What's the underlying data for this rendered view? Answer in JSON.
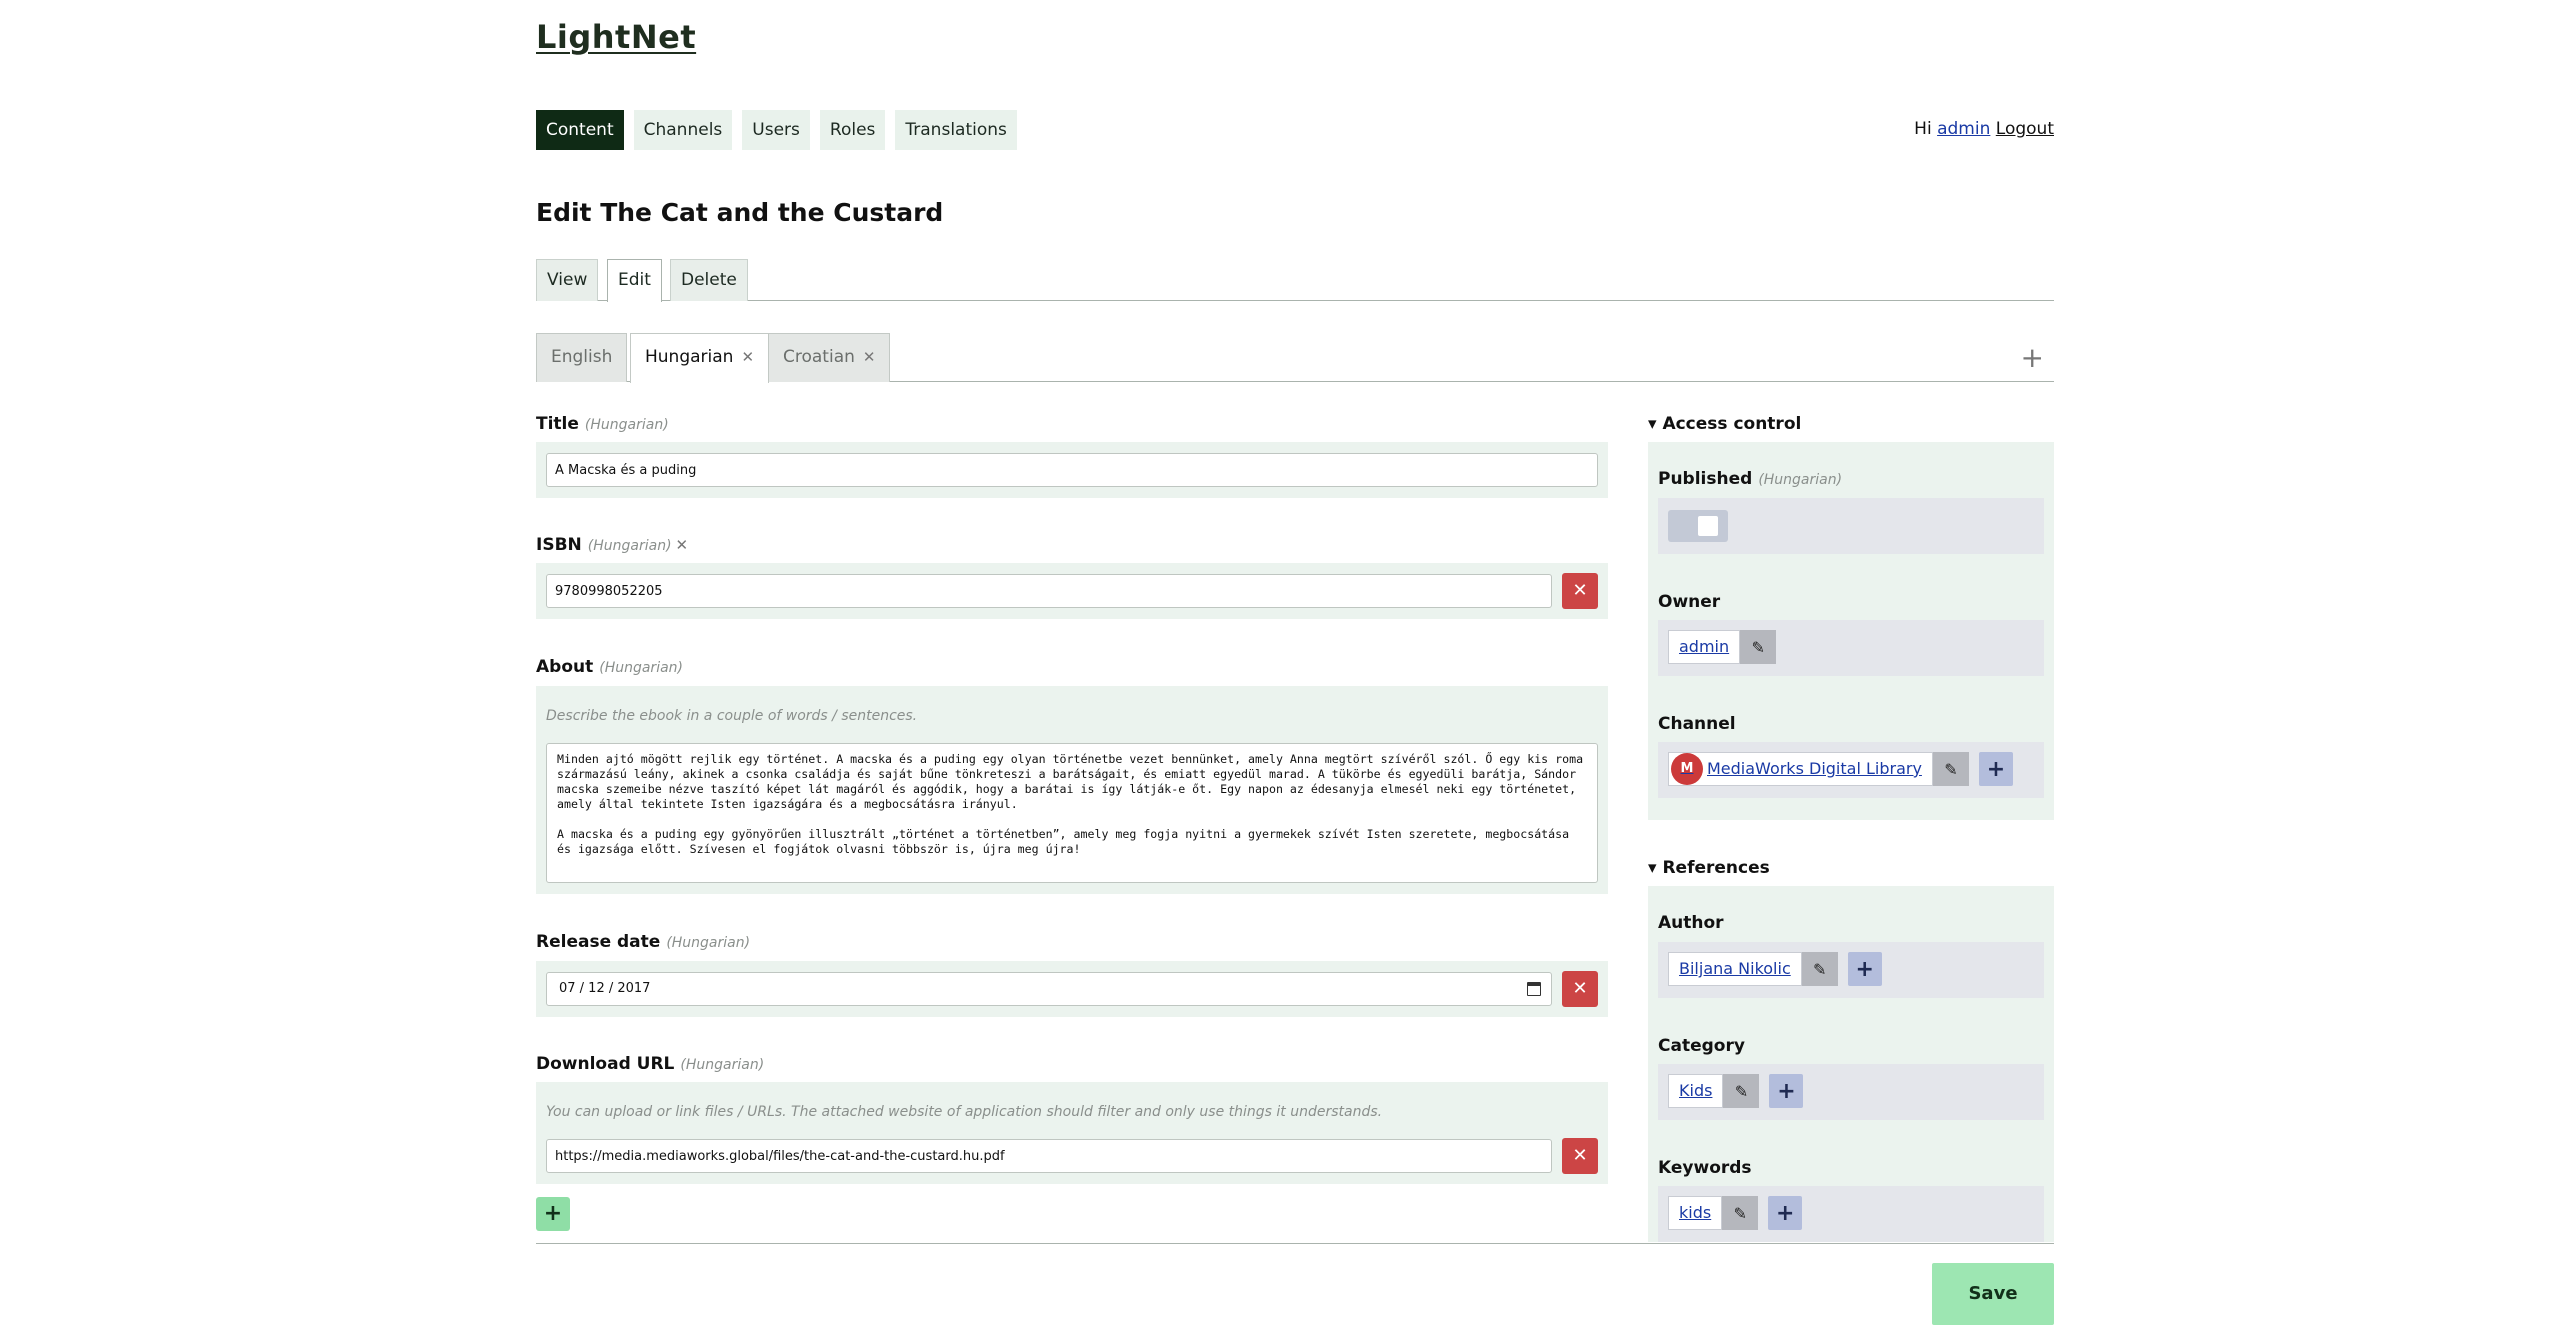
{
  "site": {
    "title": "LightNet"
  },
  "nav": {
    "items": [
      {
        "label": "Content",
        "active": true
      },
      {
        "label": "Channels",
        "active": false
      },
      {
        "label": "Users",
        "active": false
      },
      {
        "label": "Roles",
        "active": false
      },
      {
        "label": "Translations",
        "active": false
      }
    ]
  },
  "user": {
    "greeting": "Hi",
    "name": "admin",
    "logout": "Logout"
  },
  "page": {
    "title": "Edit The Cat and the Custard"
  },
  "ops_tabs": {
    "view": "View",
    "edit": "Edit",
    "delete": "Delete",
    "active": "Edit"
  },
  "lang_tabs": {
    "items": [
      {
        "label": "English",
        "active": false
      },
      {
        "label": "Hungarian",
        "active": true
      },
      {
        "label": "Croatian",
        "active": false
      }
    ],
    "close_glyph": "✕",
    "add_glyph": "+"
  },
  "lang_tag": "(Hungarian)",
  "fields": {
    "title": {
      "label": "Title",
      "value": "A Macska és a puding"
    },
    "isbn": {
      "label": "ISBN",
      "value": "9780998052205"
    },
    "about": {
      "label": "About",
      "hint": "Describe the ebook in a couple of words / sentences.",
      "value": "Minden ajtó mögött rejlik egy történet. A macska és a puding egy olyan történetbe vezet bennünket, amely Anna megtört szívéről szól. Ő egy kis roma származású leány, akinek a csonka családja és saját bűne tönkreteszi a barátságait, és emiatt egyedül marad. A tükörbe és egyedüli barátja, Sándor macska szemeibe nézve taszító képet lát magáról és aggódik, hogy a barátai is így látják-e őt. Egy napon az édesanyja elmesél neki egy történetet, amely által tekintete Isten igazságára és a megbocsátásra irányul.\n\nA macska és a puding egy gyönyörűen illusztrált „történet a történetben”, amely meg fogja nyitni a gyermekek szívét Isten szeretete, megbocsátása és igazsága előtt. Szívesen el fogjátok olvasni többször is, újra meg újra!"
    },
    "release_date": {
      "label": "Release date",
      "value": "07 / 12 / 2017"
    },
    "download_url": {
      "label": "Download URL",
      "hint": "You can upload or link files / URLs. The attached website of application should filter and only use things it understands.",
      "value": "https://media.mediaworks.global/files/the-cat-and-the-custard.hu.pdf"
    }
  },
  "access_control": {
    "title": "▾ Access control",
    "published": {
      "label": "Published",
      "value": false
    },
    "owner": {
      "label": "Owner",
      "value": "admin"
    },
    "channel": {
      "label": "Channel",
      "value": "MediaWorks Digital Library",
      "logo_text": "M"
    }
  },
  "references": {
    "title": "▾ References",
    "author": {
      "label": "Author",
      "value": "Biljana Nikolic"
    },
    "category": {
      "label": "Category",
      "value": "Kids"
    },
    "keywords": {
      "label": "Keywords",
      "value": "kids"
    }
  },
  "actions": {
    "save": "Save",
    "remove_glyph": "✕",
    "add_glyph": "+",
    "edit_glyph": "✎"
  },
  "colors": {
    "nav_active": "#0f2a15",
    "remove": "#cc4545",
    "add_green": "#8fdea6",
    "save": "#9de6b2",
    "panel": "#ebf3ee"
  }
}
